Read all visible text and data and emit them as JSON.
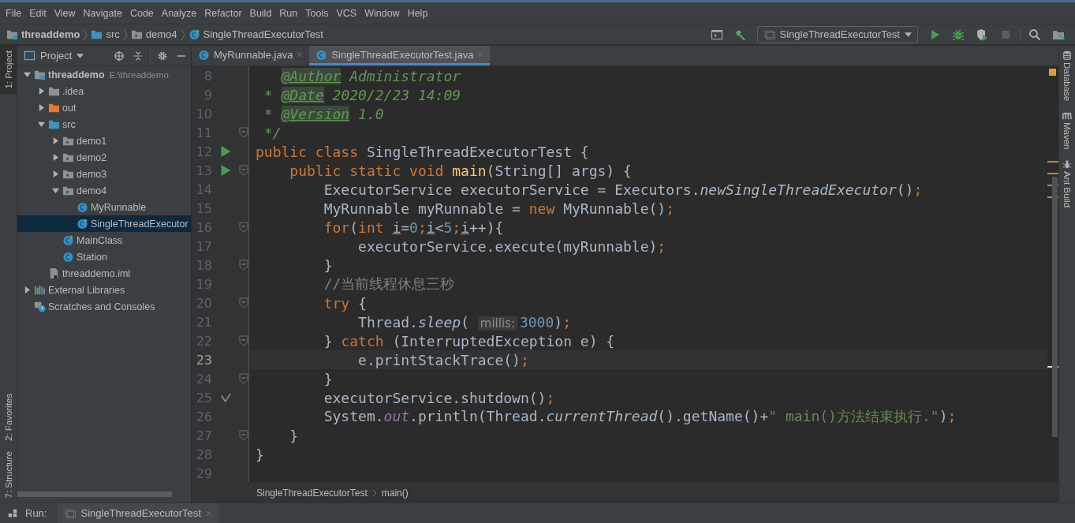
{
  "menu": [
    "File",
    "Edit",
    "View",
    "Navigate",
    "Code",
    "Analyze",
    "Refactor",
    "Build",
    "Run",
    "Tools",
    "VCS",
    "Window",
    "Help"
  ],
  "navbar": {
    "breadcrumbs": [
      {
        "label": "threaddemo",
        "kind": "module"
      },
      {
        "label": "src",
        "kind": "source-folder"
      },
      {
        "label": "demo4",
        "kind": "package"
      },
      {
        "label": "SingleThreadExecutorTest",
        "kind": "class-runnable"
      }
    ],
    "run_config": "SingleThreadExecutorTest"
  },
  "left_stripe": {
    "top": [
      {
        "label": "1: Project",
        "selected": true
      }
    ],
    "bottom": [
      {
        "label": "2: Favorites",
        "selected": false
      },
      {
        "label": "7: Structure",
        "selected": false
      }
    ]
  },
  "project_panel": {
    "title": "Project",
    "tree": [
      {
        "label": "threaddemo",
        "hint": "E:\\threaddemo",
        "kind": "module",
        "expanded": true,
        "selected": false,
        "children": [
          {
            "label": ".idea",
            "kind": "folder",
            "expanded": false,
            "selected": false
          },
          {
            "label": "out",
            "kind": "excluded",
            "expanded": false,
            "selected": false
          },
          {
            "label": "src",
            "kind": "source-folder",
            "expanded": true,
            "selected": false,
            "children": [
              {
                "label": "demo1",
                "kind": "package",
                "expanded": false,
                "selected": false
              },
              {
                "label": "demo2",
                "kind": "package",
                "expanded": false,
                "selected": false
              },
              {
                "label": "demo3",
                "kind": "package",
                "expanded": false,
                "selected": false
              },
              {
                "label": "demo4",
                "kind": "package",
                "expanded": true,
                "selected": false,
                "children": [
                  {
                    "label": "MyRunnable",
                    "kind": "class",
                    "selected": false
                  },
                  {
                    "label": "SingleThreadExecutor",
                    "kind": "class-runnable",
                    "selected": true
                  }
                ]
              },
              {
                "label": "MainClass",
                "kind": "class-runnable",
                "selected": false
              },
              {
                "label": "Station",
                "kind": "class",
                "selected": false
              }
            ]
          },
          {
            "label": "threaddemo.iml",
            "kind": "iml",
            "selected": false
          }
        ]
      },
      {
        "label": "External Libraries",
        "kind": "libraries",
        "expanded": false,
        "selected": false
      },
      {
        "label": "Scratches and Consoles",
        "kind": "scratches",
        "selected": false
      }
    ]
  },
  "tabs": [
    {
      "label": "MyRunnable.java",
      "selected": false
    },
    {
      "label": "SingleThreadExecutorTest.java",
      "selected": true
    }
  ],
  "editor": {
    "lines": [
      {
        "number": "8",
        "tokens": [
          {
            "kind": "doctag",
            "text": "@Author"
          },
          {
            "kind": "doc",
            "text": " Administrator"
          }
        ]
      },
      {
        "number": "9",
        "tokens": [
          {
            "kind": "doc",
            "text": " * "
          },
          {
            "kind": "doctag",
            "text": "@Date"
          },
          {
            "kind": "doc",
            "text": " 2020/2/23 14:09"
          }
        ]
      },
      {
        "number": "10",
        "tokens": [
          {
            "kind": "doc",
            "text": " * "
          },
          {
            "kind": "doctag",
            "text": "@Version"
          },
          {
            "kind": "doc",
            "text": " 1.0"
          }
        ]
      },
      {
        "number": "11",
        "fold": true,
        "tokens": [
          {
            "kind": "doc",
            "text": " */"
          }
        ]
      },
      {
        "number": "12",
        "runnable": true,
        "tokens": [
          {
            "kind": "kw",
            "text": "public class "
          },
          {
            "kind": "plain",
            "text": "SingleThreadExecutorTest {"
          }
        ]
      },
      {
        "number": "13",
        "runnable": true,
        "fold": true,
        "tokens": [
          {
            "kind": "kw",
            "text": "    public static void "
          },
          {
            "kind": "method",
            "text": "main"
          },
          {
            "kind": "plain",
            "text": "(String[] args) {"
          }
        ]
      },
      {
        "number": "14",
        "tokens": [
          {
            "kind": "plain",
            "text": "        ExecutorService executorService = Executors."
          },
          {
            "kind": "italic",
            "text": "newSingleThreadExecutor"
          },
          {
            "kind": "plain",
            "text": "()"
          },
          {
            "kind": "kw",
            "text": ";"
          }
        ]
      },
      {
        "number": "15",
        "tokens": [
          {
            "kind": "plain",
            "text": "        MyRunnable myRunnable = "
          },
          {
            "kind": "kw",
            "text": "new "
          },
          {
            "kind": "plain",
            "text": "MyRunnable()"
          },
          {
            "kind": "kw",
            "text": ";"
          }
        ]
      },
      {
        "number": "16",
        "fold": true,
        "tokens": [
          {
            "kind": "kw",
            "text": "        for"
          },
          {
            "kind": "plain",
            "text": "("
          },
          {
            "kind": "kw",
            "text": "int "
          },
          {
            "kind": "var",
            "text": "i"
          },
          {
            "kind": "plain",
            "text": "="
          },
          {
            "kind": "num",
            "text": "0"
          },
          {
            "kind": "kw",
            "text": ";"
          },
          {
            "kind": "var",
            "text": "i"
          },
          {
            "kind": "plain",
            "text": "<"
          },
          {
            "kind": "num",
            "text": "5"
          },
          {
            "kind": "kw",
            "text": ";"
          },
          {
            "kind": "var",
            "text": "i"
          },
          {
            "kind": "plain",
            "text": "++){"
          }
        ]
      },
      {
        "number": "17",
        "tokens": [
          {
            "kind": "plain",
            "text": "            executorService.execute(myRunnable)"
          },
          {
            "kind": "kw",
            "text": ";"
          }
        ]
      },
      {
        "number": "18",
        "fold": true,
        "tokens": [
          {
            "kind": "plain",
            "text": "        }"
          }
        ]
      },
      {
        "number": "19",
        "tokens": [
          {
            "kind": "comment",
            "text": "        //当前线程休息三秒"
          }
        ]
      },
      {
        "number": "20",
        "fold": true,
        "tokens": [
          {
            "kind": "kw",
            "text": "        try "
          },
          {
            "kind": "plain",
            "text": "{"
          }
        ]
      },
      {
        "number": "21",
        "tokens": [
          {
            "kind": "plain",
            "text": "            Thread."
          },
          {
            "kind": "italic",
            "text": "sleep"
          },
          {
            "kind": "plain",
            "text": "( "
          },
          {
            "kind": "hint",
            "text": "millis:"
          },
          {
            "kind": "num",
            "text": "3000"
          },
          {
            "kind": "plain",
            "text": ")"
          },
          {
            "kind": "kw",
            "text": ";"
          }
        ]
      },
      {
        "number": "22",
        "fold": true,
        "tokens": [
          {
            "kind": "plain",
            "text": "        } "
          },
          {
            "kind": "kw",
            "text": "catch "
          },
          {
            "kind": "plain",
            "text": "(InterruptedException e) {"
          }
        ]
      },
      {
        "number": "23",
        "current": true,
        "tokens": [
          {
            "kind": "plain",
            "text": "            e.printStackTrace()"
          },
          {
            "kind": "kw",
            "text": ";"
          }
        ]
      },
      {
        "number": "24",
        "fold": true,
        "tokens": [
          {
            "kind": "plain",
            "text": "        }"
          }
        ]
      },
      {
        "number": "25",
        "passed": true,
        "tokens": [
          {
            "kind": "plain",
            "text": "        executorService.shutdown()"
          },
          {
            "kind": "kw",
            "text": ";"
          }
        ]
      },
      {
        "number": "26",
        "tokens": [
          {
            "kind": "plain",
            "text": "        System."
          },
          {
            "kind": "field",
            "text": "out"
          },
          {
            "kind": "plain",
            "text": ".println(Thread."
          },
          {
            "kind": "italic",
            "text": "currentThread"
          },
          {
            "kind": "plain",
            "text": "().getName()+"
          },
          {
            "kind": "str",
            "text": "\" main()方法结束执行.\""
          },
          {
            "kind": "plain",
            "text": ")"
          },
          {
            "kind": "kw",
            "text": ";"
          }
        ]
      },
      {
        "number": "27",
        "fold": true,
        "tokens": [
          {
            "kind": "plain",
            "text": "    }"
          }
        ]
      },
      {
        "number": "28",
        "tokens": [
          {
            "kind": "plain",
            "text": "}"
          }
        ]
      },
      {
        "number": "29"
      }
    ]
  },
  "code_breadcrumbs": [
    "SingleThreadExecutorTest",
    "main()"
  ],
  "run_bar": {
    "label": "Run:",
    "tab": "SingleThreadExecutorTest"
  },
  "right_stripe": [
    {
      "label": "Database",
      "kind": "database"
    },
    {
      "label": "Maven",
      "kind": "maven"
    },
    {
      "label": "Ant Build",
      "kind": "ant"
    }
  ]
}
